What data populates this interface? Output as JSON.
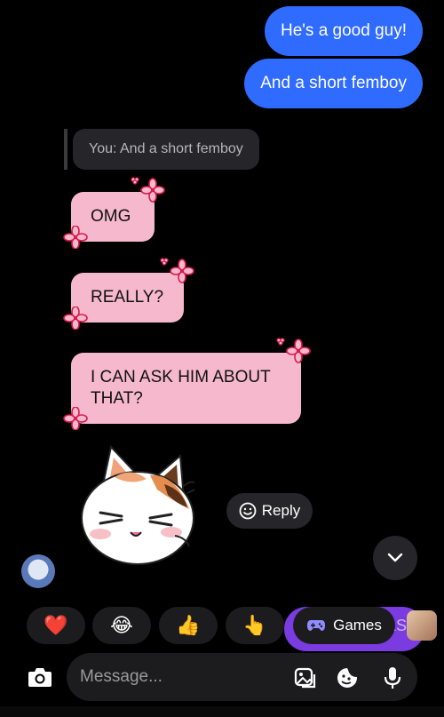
{
  "outgoing": [
    {
      "text": "He's a good guy!"
    },
    {
      "text": "And a short femboy"
    }
  ],
  "reply_reference": {
    "text": "You: And a short femboy"
  },
  "incoming": [
    {
      "text": "OMG"
    },
    {
      "text": "REALLY?"
    },
    {
      "text": "I CAN ASK HIM ABOUT THAT?"
    }
  ],
  "sticker": {
    "icon": "cat-sticker"
  },
  "reply_button": {
    "label": "Reply"
  },
  "quick_reactions": [
    {
      "emoji": "❤️",
      "icon": "heart-icon"
    },
    {
      "emoji": "😂",
      "icon": "laughing-emoji-icon"
    },
    {
      "emoji": "👍",
      "icon": "thumbs-up-icon"
    },
    {
      "emoji": "👆",
      "icon": "pointing-hand-icon"
    }
  ],
  "games": {
    "label": "Games",
    "tail_text": "LS"
  },
  "composer": {
    "placeholder": "Message..."
  },
  "colors": {
    "outgoing_bubble": "#2f6bff",
    "incoming_bubble": "#f6b8cd",
    "background": "#000000",
    "accent_purple": "#7a3be0"
  }
}
